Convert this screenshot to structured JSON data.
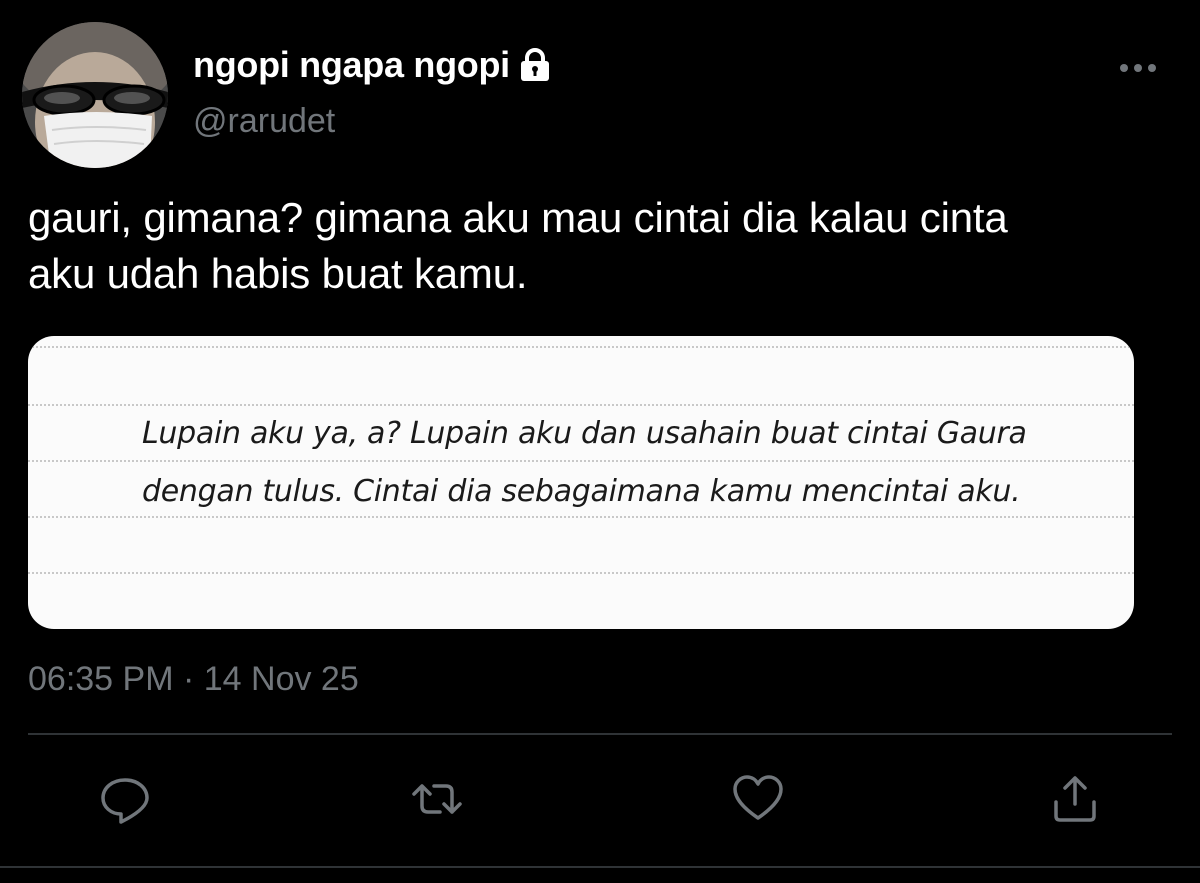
{
  "user": {
    "display_name": "ngopi ngapa ngopi",
    "handle": "@rarudet",
    "protected_icon": "lock-icon",
    "avatar": "profile-photo"
  },
  "tweet": {
    "text": "gauri, gimana? gimana aku mau cintai dia kalau cinta\naku udah habis buat kamu.",
    "media_lines": [
      "Lupain aku ya, a? Lupain aku dan usahain buat cintai Gaura",
      "dengan tulus. Cintai dia sebagaimana kamu mencintai aku."
    ],
    "timestamp": "06:35 PM · 14 Nov 25"
  },
  "actions": [
    {
      "name": "reply",
      "icon": "reply-icon"
    },
    {
      "name": "retweet",
      "icon": "retweet-icon"
    },
    {
      "name": "like",
      "icon": "heart-icon"
    },
    {
      "name": "share",
      "icon": "share-icon"
    }
  ],
  "more_icon": "more-icon",
  "colors": {
    "background": "#000000",
    "primary_text": "#ffffff",
    "secondary_text": "#71767b",
    "divider": "#2f3336",
    "media_background": "#fbfbfb"
  }
}
